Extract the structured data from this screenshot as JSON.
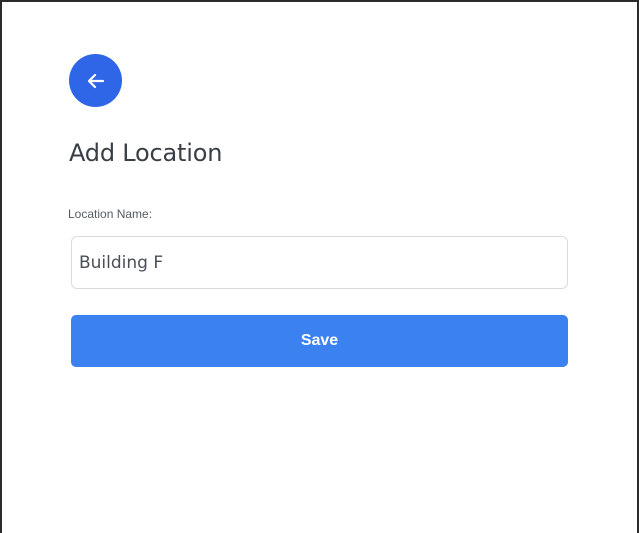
{
  "form": {
    "title": "Add Location",
    "location_label": "Location Name:",
    "location_value": "Building F",
    "save_label": "Save"
  },
  "icons": {
    "back": "arrow-left-icon"
  },
  "colors": {
    "primary": "#2f66e8",
    "save_button": "#3c81f0",
    "title_text": "#3a3f47",
    "input_border": "#d8dbe0"
  }
}
